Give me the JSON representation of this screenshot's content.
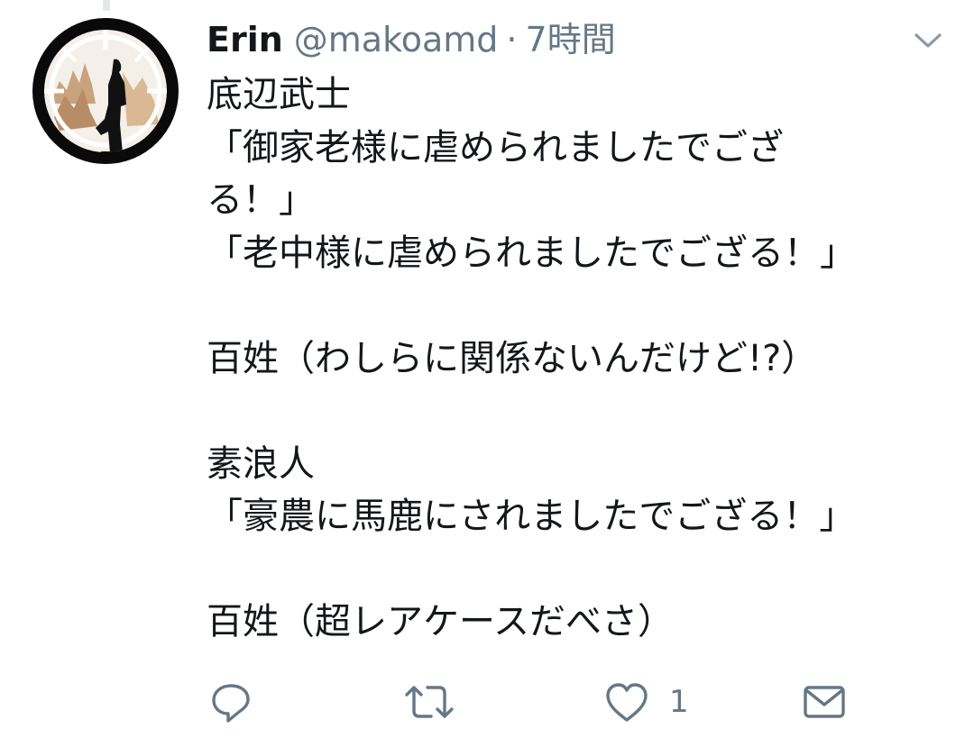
{
  "tweet": {
    "name": "Erin",
    "handle": "@makoamd",
    "separator": "·",
    "time": "7時間",
    "body_lines": [
      "底辺武士",
      "「御家老様に虐められましたでござ",
      "る！」",
      "「老中様に虐められましたでござる！」",
      "",
      "百姓（わしらに関係ないんだけど!?）",
      "",
      "素浪人",
      "「豪農に馬鹿にされましたでござる！」",
      "",
      "百姓（超レアケースだべさ）"
    ],
    "like_count": "1"
  },
  "icons": {
    "avatar": "profile-avatar",
    "caret": "chevron-down-icon",
    "reply": "reply-icon",
    "retweet": "retweet-icon",
    "like": "heart-icon",
    "dm": "envelope-icon"
  },
  "colors": {
    "text": "#14171a",
    "secondary": "#657786",
    "thread_line": "#e1e8ed"
  }
}
